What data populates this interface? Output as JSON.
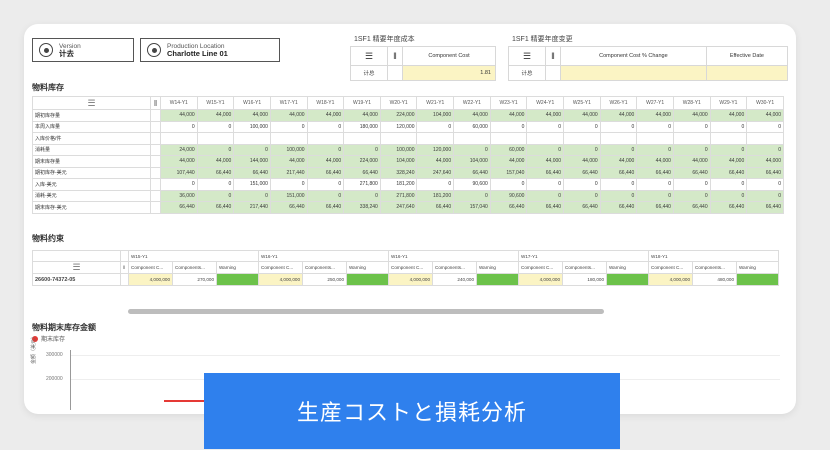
{
  "selectors": [
    {
      "label": "Version",
      "value": "计去"
    },
    {
      "label": "Production Location",
      "value": "Charlotte Line 01"
    }
  ],
  "top_tables": [
    {
      "title": "1SF1 精要年度成本",
      "col_header": "Component Cost",
      "row_label": "计总",
      "value": "1.81"
    },
    {
      "title": "1SF1 精要年度变更",
      "col_headers": [
        "Component Cost % Change",
        "Effective Date"
      ],
      "row_label": "计总"
    }
  ],
  "material_inventory": {
    "title": "物料库存",
    "weeks": [
      "W14-Y1",
      "W15-Y1",
      "W16-Y1",
      "W17-Y1",
      "W18-Y1",
      "W19-Y1",
      "W20-Y1",
      "W21-Y1",
      "W22-Y1",
      "W23-Y1",
      "W24-Y1",
      "W25-Y1",
      "W26-Y1",
      "W27-Y1",
      "W28-Y1",
      "W29-Y1",
      "W30-Y1"
    ],
    "rows": [
      {
        "label": "期初库存量",
        "cells": [
          "44,000",
          "44,000",
          "44,000",
          "44,000",
          "44,000",
          "44,000",
          "224,000",
          "104,000",
          "44,000",
          "44,000",
          "44,000",
          "44,000",
          "44,000",
          "44,000",
          "44,000",
          "44,000",
          "44,000"
        ],
        "green": true
      },
      {
        "label": "本周入库量",
        "cells": [
          "0",
          "0",
          "100,000",
          "0",
          "0",
          "180,000",
          "120,000",
          "0",
          "60,000",
          "0",
          "0",
          "0",
          "0",
          "0",
          "0",
          "0",
          "0"
        ],
        "green": false
      },
      {
        "label": "入库价格/件",
        "cells": [
          "",
          "",
          "",
          "",
          "",
          "",
          "",
          "",
          "",
          "",
          "",
          "",
          "",
          "",
          "",
          "",
          ""
        ],
        "green": false
      },
      {
        "label": "消耗量",
        "cells": [
          "24,000",
          "0",
          "0",
          "100,000",
          "0",
          "0",
          "100,000",
          "120,000",
          "0",
          "60,000",
          "0",
          "0",
          "0",
          "0",
          "0",
          "0",
          "0"
        ],
        "green": true
      },
      {
        "label": "期末库存量",
        "cells": [
          "44,000",
          "44,000",
          "144,000",
          "44,000",
          "44,000",
          "224,000",
          "104,000",
          "44,000",
          "104,000",
          "44,000",
          "44,000",
          "44,000",
          "44,000",
          "44,000",
          "44,000",
          "44,000",
          "44,000"
        ],
        "green": true
      },
      {
        "label": "期初库存-美元",
        "cells": [
          "107,440",
          "66,440",
          "66,440",
          "217,440",
          "66,440",
          "66,440",
          "328,240",
          "247,640",
          "66,440",
          "157,040",
          "66,440",
          "66,440",
          "66,440",
          "66,440",
          "66,440",
          "66,440",
          "66,440"
        ],
        "green": true
      },
      {
        "label": "入库-美元",
        "cells": [
          "0",
          "0",
          "151,000",
          "0",
          "0",
          "271,800",
          "181,200",
          "0",
          "90,600",
          "0",
          "0",
          "0",
          "0",
          "0",
          "0",
          "0",
          "0"
        ],
        "green": false
      },
      {
        "label": "消耗-美元",
        "cells": [
          "36,000",
          "0",
          "0",
          "151,000",
          "0",
          "0",
          "271,800",
          "181,200",
          "0",
          "90,600",
          "0",
          "0",
          "0",
          "0",
          "0",
          "0",
          "0"
        ],
        "green": true
      },
      {
        "label": "期末库存-美元",
        "cells": [
          "66,440",
          "66,440",
          "217,440",
          "66,440",
          "66,440",
          "338,240",
          "247,640",
          "66,440",
          "157,040",
          "66,440",
          "66,440",
          "66,440",
          "66,440",
          "66,440",
          "66,440",
          "66,440",
          "66,440"
        ],
        "green": true
      }
    ]
  },
  "material_consumption": {
    "title": "物料约束",
    "weeks": [
      "W15-Y1",
      "W16-Y1",
      "W16-Y1",
      "W17-Y1",
      "W18-Y1"
    ],
    "sub_headers": [
      "Component C...",
      "Components...",
      "Warning"
    ],
    "row_label": "26600-74372-05",
    "values": [
      {
        "cost": "4,000,000",
        "comp": "270,000"
      },
      {
        "cost": "4,000,000",
        "comp": "250,000"
      },
      {
        "cost": "4,000,000",
        "comp": "240,000"
      },
      {
        "cost": "4,000,000",
        "comp": "180,000"
      },
      {
        "cost": "4,000,000",
        "comp": "480,000"
      }
    ]
  },
  "chart_section": {
    "title": "物料期末库存金额",
    "legend": "期末库存",
    "y_ticks": [
      "300000",
      "200000"
    ],
    "y_label": "金额（美元）"
  },
  "banner": "生産コストと損耗分析"
}
